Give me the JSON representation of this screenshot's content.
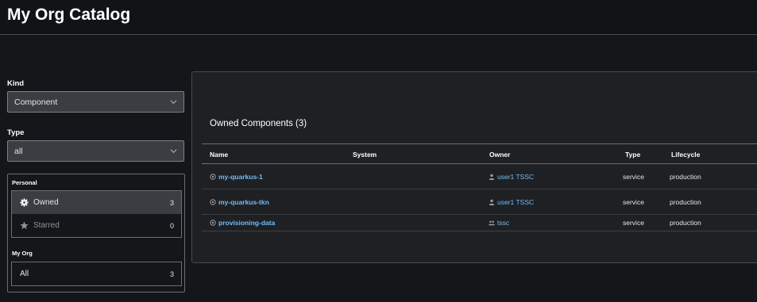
{
  "header": {
    "title": "My Org Catalog"
  },
  "filters": {
    "kind": {
      "label": "Kind",
      "value": "Component"
    },
    "type": {
      "label": "Type",
      "value": "all"
    }
  },
  "user_list": {
    "personal_label": "Personal",
    "personal_items": [
      {
        "label": "Owned",
        "count": "3",
        "icon": "gear-icon"
      },
      {
        "label": "Starred",
        "count": "0",
        "icon": "star-icon"
      }
    ],
    "org_label": "My Org",
    "org_items": [
      {
        "label": "All",
        "count": "3"
      }
    ]
  },
  "table": {
    "title": "Owned Components (3)",
    "columns": [
      "Name",
      "System",
      "Owner",
      "Type",
      "Lifecycle"
    ],
    "rows": [
      {
        "name": "my-quarkus-1",
        "system": "",
        "owner": "user1 TSSC",
        "owner_icon": "user-icon",
        "type": "service",
        "lifecycle": "production"
      },
      {
        "name": "my-quarkus-tkn",
        "system": "",
        "owner": "user1 TSSC",
        "owner_icon": "user-icon",
        "type": "service",
        "lifecycle": "production"
      },
      {
        "name": "provisioning-data",
        "system": "",
        "owner": "tssc",
        "owner_icon": "group-icon",
        "type": "service",
        "lifecycle": "production"
      }
    ]
  },
  "colors": {
    "background": "#151619",
    "card": "#1f2024",
    "link": "#73bcf7",
    "selected_row": "#3b3d42"
  }
}
